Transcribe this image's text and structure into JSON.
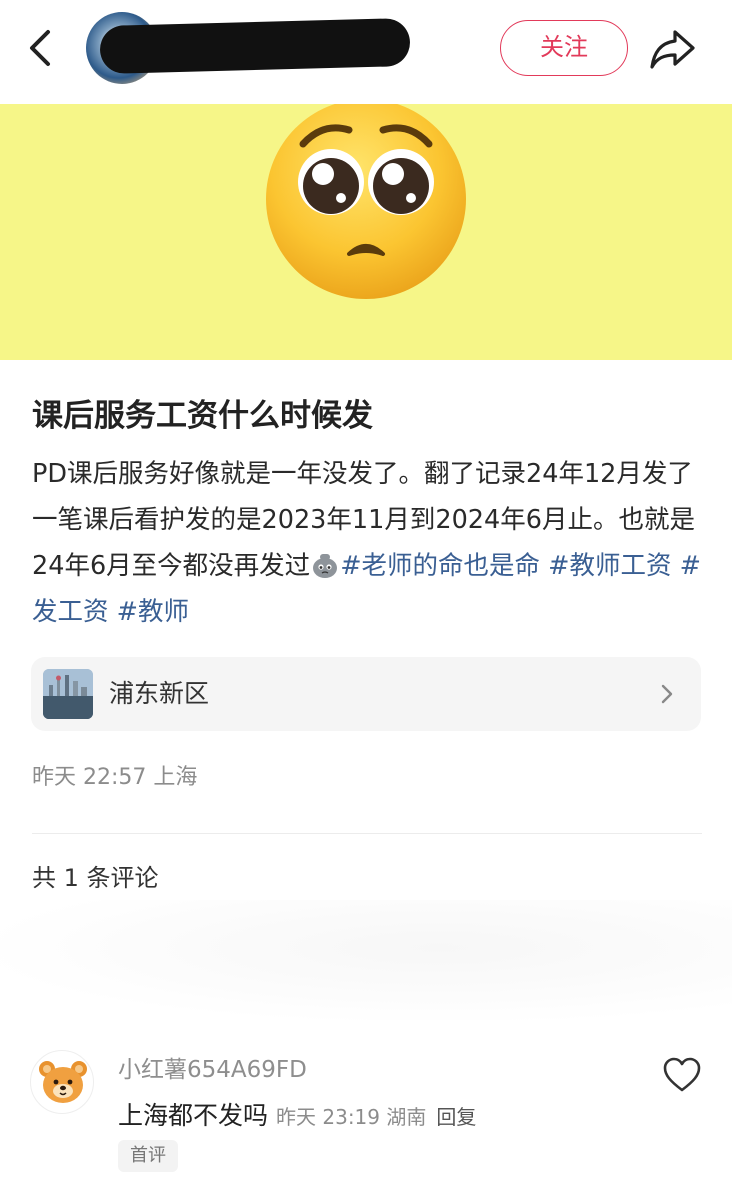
{
  "header": {
    "back_icon": "chevron-left-icon",
    "follow_label": "关注",
    "share_icon": "share-arrow-icon",
    "accent_color": "#e23a5a"
  },
  "banner": {
    "background_color": "#f6f688",
    "emoji": "pleading-face-emoji"
  },
  "post": {
    "title": "课后服务工资什么时候发",
    "body": "PD课后服务好像就是一年没发了。翻了记录24年12月发了一笔课后看护发的是2023年11月到2024年6月止。也就是24年6月至今都没再发过",
    "inline_emoji": "crying-bag-emoji",
    "hashtags": [
      "#老师的命也是命",
      "#教师工资",
      "#发工资",
      "#教师"
    ],
    "hashtag_color": "#3a5f93"
  },
  "location": {
    "name": "浦东新区",
    "chevron_icon": "chevron-right-icon"
  },
  "meta": {
    "time_location": "昨天 22:57 上海"
  },
  "comments": {
    "count_label": "共 1 条评论",
    "items": [
      {
        "user": "小红薯654A69FD",
        "text": "上海都不发吗",
        "meta": "昨天 23:19 湖南",
        "reply_label": "回复",
        "badge": "首评",
        "avatar_icon": "bear-avatar-icon",
        "like_icon": "heart-outline-icon"
      }
    ]
  }
}
